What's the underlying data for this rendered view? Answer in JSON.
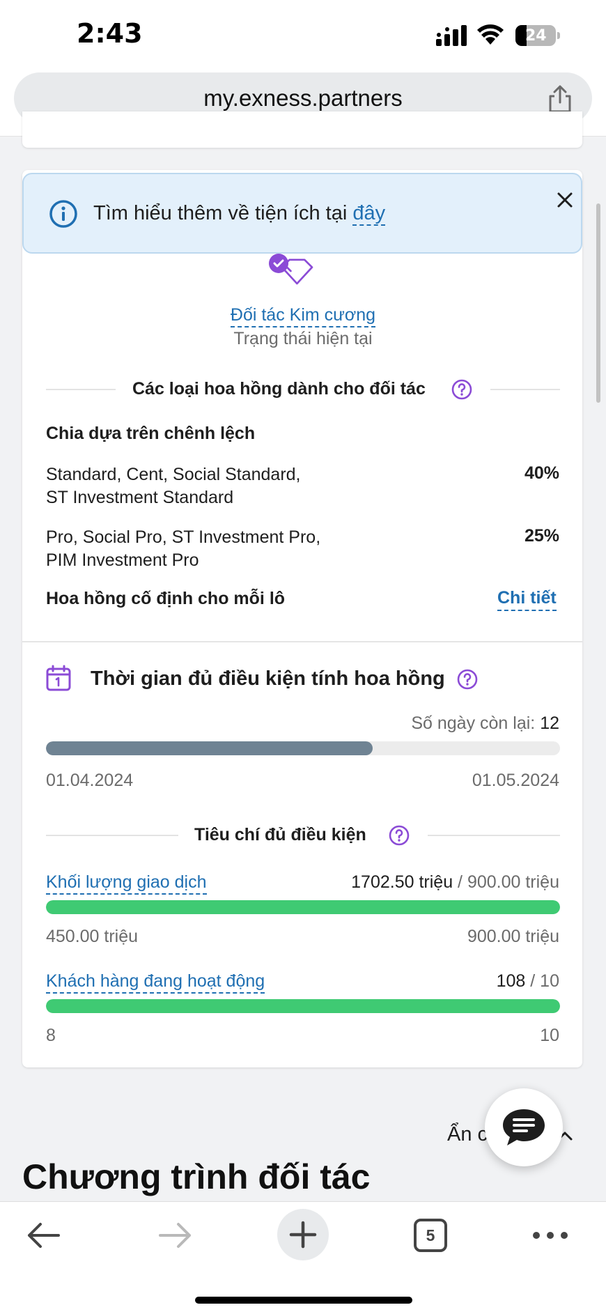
{
  "status_bar": {
    "time": "2:43",
    "battery": "24"
  },
  "browser": {
    "url": "my.exness.partners",
    "tabs_count": "5"
  },
  "info_banner": {
    "text": "Tìm hiểu thêm về tiện ích tại",
    "link": "đây"
  },
  "tier": {
    "name": "Đối tác Kim cương",
    "status": "Trạng thái hiện tại"
  },
  "commission": {
    "title": "Các loại hoa hồng dành cho đối tác",
    "spread_title": "Chia dựa trên chênh lệch",
    "rows": [
      {
        "line1": "Standard, Cent, Social Standard,",
        "line2": "ST Investment Standard",
        "value": "40%"
      },
      {
        "line1": "Pro, Social Pro, ST Investment Pro,",
        "line2": "PIM Investment Pro",
        "value": "25%"
      }
    ],
    "fixed_label": "Hoa hồng cố định cho mỗi lô",
    "fixed_link": "Chi tiết"
  },
  "period": {
    "title": "Thời gian đủ điều kiện tính hoa hồng",
    "days_left_label": "Số ngày còn lại:",
    "days_left": "12",
    "progress": 0.635,
    "start_date": "01.04.2024",
    "end_date": "01.05.2024"
  },
  "criteria": {
    "title": "Tiêu chí đủ điều kiện",
    "metrics": [
      {
        "label": "Khối lượng giao dịch",
        "current": "1702.50 triệu",
        "target": " / 900.00 triệu",
        "progress": 1.0,
        "min": "450.00 triệu",
        "max": "900.00 triệu"
      },
      {
        "label": "Khách hàng đang hoạt động",
        "current": "108",
        "target": " / 10",
        "progress": 1.0,
        "min": "8",
        "max": "10"
      }
    ]
  },
  "footer": {
    "hide_text": "Ẩn c",
    "program_title": "Chương trình đối tác"
  },
  "colors": {
    "link": "#1f6fb2",
    "accent": "#8b4bd6",
    "green": "#3fca73",
    "gray_bar": "#6f8393"
  }
}
